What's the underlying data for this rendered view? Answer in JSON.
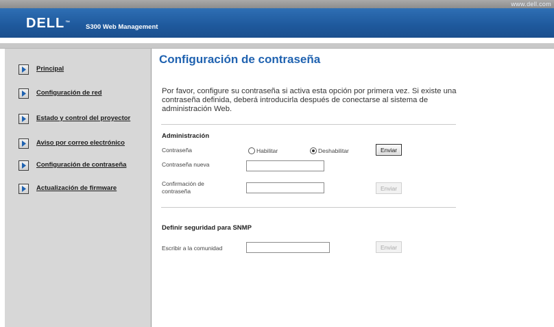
{
  "topbar": {
    "url": "www.dell.com"
  },
  "header": {
    "logo": "DELL",
    "logo_mark": "™",
    "title": "S300 Web Management"
  },
  "sidebar": {
    "items": [
      {
        "label": "Principal"
      },
      {
        "label": "Configuración de red"
      },
      {
        "label": "Estado y control del proyector"
      },
      {
        "label": "Aviso por correo electrónico"
      },
      {
        "label": "Configuración de contraseña"
      },
      {
        "label": "Actualización de firmware"
      }
    ]
  },
  "main": {
    "title": "Configuración de contraseña",
    "intro": "Por favor, configure su contraseña si activa esta opción por primera vez. Si existe una contraseña definida, deberá introducirla después de conectarse al sistema de administración Web.",
    "admin": {
      "title": "Administración",
      "password_label": "Contraseña",
      "enable_label": "Habilitar",
      "disable_label": "Deshabilitar",
      "selected": "Deshabilitar",
      "submit_label": "Enviar",
      "new_password_label": "Contraseña nueva",
      "new_password_value": "",
      "confirm_label_1": "Confirmación de",
      "confirm_label_2": "contraseña",
      "confirm_value": "",
      "confirm_submit_label": "Enviar"
    },
    "snmp": {
      "title": "Definir seguridad para SNMP",
      "community_label": "Escribir a la comunidad",
      "community_value": "",
      "submit_label": "Enviar"
    }
  }
}
